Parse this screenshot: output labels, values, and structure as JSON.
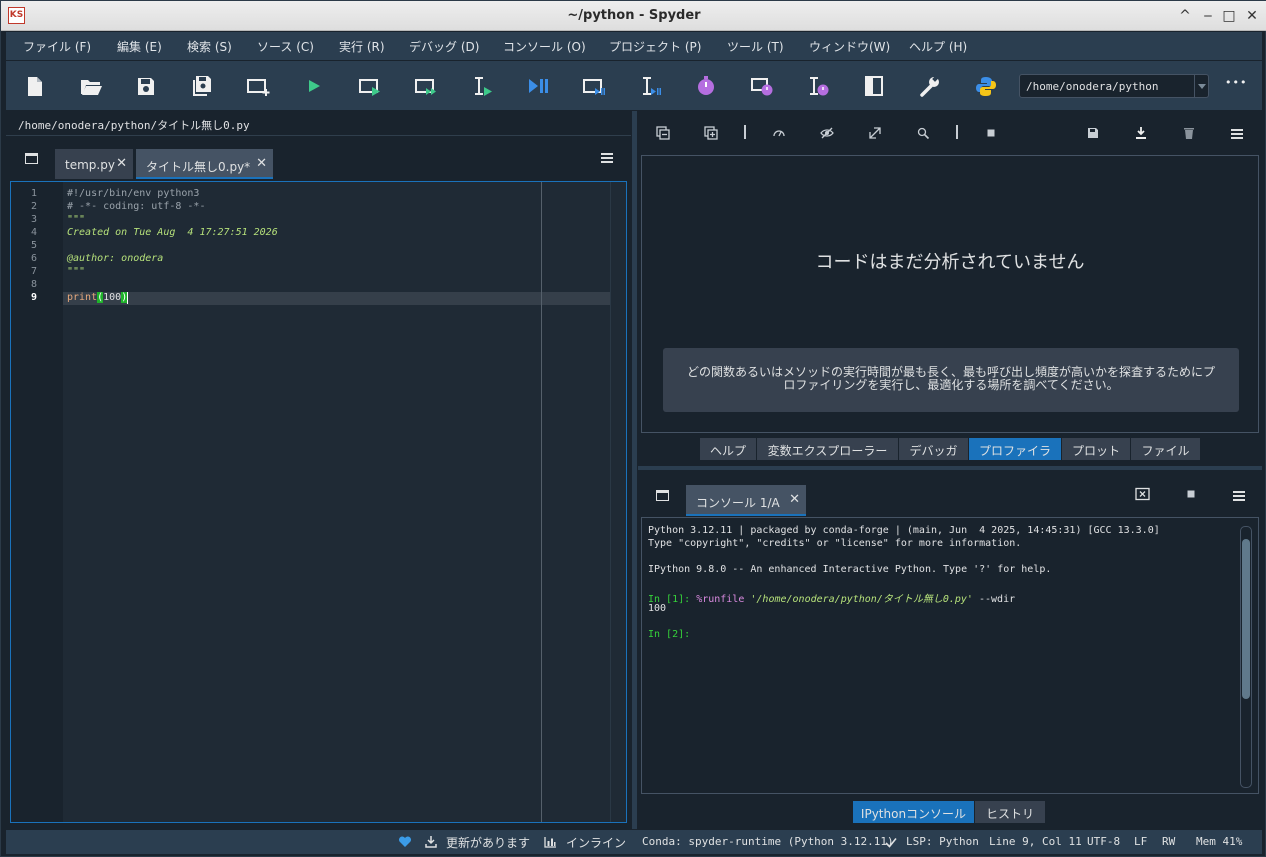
{
  "window": {
    "title": "~/python - Spyder",
    "logo": "spyder-logo",
    "controls": [
      "^",
      "‒",
      "□",
      "✕"
    ]
  },
  "menu": [
    {
      "label": "ファイル (F)"
    },
    {
      "label": "編集 (E)"
    },
    {
      "label": "検索 (S)"
    },
    {
      "label": "ソース (C)"
    },
    {
      "label": "実行 (R)"
    },
    {
      "label": "デバッグ (D)"
    },
    {
      "label": "コンソール (O)"
    },
    {
      "label": "プロジェクト (P)"
    },
    {
      "label": "ツール (T)"
    },
    {
      "label": "ウィンドウ(W)"
    },
    {
      "label": "ヘルプ (H)"
    }
  ],
  "toolbar": {
    "icons": [
      "new-file-icon",
      "open-file-icon",
      "save-icon",
      "save-all-icon",
      "new-cell-icon",
      "run-icon",
      "run-cell-icon",
      "run-cell-advance-icon",
      "run-selection-icon",
      "debug-icon",
      "debug-cell-icon",
      "debug-selection-icon",
      "profile-icon",
      "profile-cell-icon",
      "profile-selection-icon",
      "maximize-pane-icon",
      "preferences-icon",
      "python-path-icon"
    ],
    "working_dir": "/home/onodera/python",
    "more": "•••"
  },
  "editor": {
    "file_path": "/home/onodera/python/タイトル無し0.py",
    "tabs": [
      {
        "label": "temp.py",
        "active": false
      },
      {
        "label": "タイトル無し0.py*",
        "active": true
      }
    ],
    "current_line": "9",
    "lines": [
      {
        "n": "1",
        "text": "#!/usr/bin/env python3"
      },
      {
        "n": "2",
        "text": "# -*- coding: utf-8 -*-"
      },
      {
        "n": "3",
        "text": "\"\"\""
      },
      {
        "n": "4",
        "text": "Created on Tue Aug  4 17:27:51 2026"
      },
      {
        "n": "5",
        "text": ""
      },
      {
        "n": "6",
        "text": "@author: onodera"
      },
      {
        "n": "7",
        "text": "\"\"\""
      },
      {
        "n": "8",
        "text": ""
      },
      {
        "n": "9",
        "text": "print(100)"
      }
    ],
    "line9": {
      "fn": "print",
      "open": "(",
      "arg": "100",
      "close": ")"
    }
  },
  "profiler": {
    "heading": "コードはまだ分析されていません",
    "description": "どの関数あるいはメソッドの実行時間が最も長く、最も呼び出し頻度が高いかを探査するためにプロファイリングを実行し、最適化する場所を調べてください。",
    "tabs": [
      {
        "label": "ヘルプ"
      },
      {
        "label": "変数エクスプローラー"
      },
      {
        "label": "デバッガ"
      },
      {
        "label": "プロファイラ",
        "active": true
      },
      {
        "label": "プロット"
      },
      {
        "label": "ファイル"
      }
    ]
  },
  "console": {
    "tab_label": "コンソール 1/A",
    "lines": {
      "l1": "Python 3.12.11 | packaged by conda-forge | (main, Jun  4 2025, 14:45:31) [GCC 13.3.0]",
      "l2": "Type \"copyright\", \"credits\" or \"license\" for more information.",
      "l3": "IPython 9.8.0 -- An enhanced Interactive Python. Type '?' for help.",
      "in1_prompt": "In [1]:",
      "in1_magic": "%runfile",
      "in1_path": "'/home/onodera/python/タイトル無し0.py'",
      "in1_opt": "--wdir",
      "out1": "100",
      "in2_prompt": "In [2]:"
    },
    "tabs": [
      {
        "label": "IPythonコンソール",
        "active": true
      },
      {
        "label": "ヒストリ"
      }
    ]
  },
  "status": {
    "update": "更新があります",
    "inline": "インライン",
    "conda": "Conda: spyder-runtime (Python 3.12.11)",
    "lsp": "LSP: Python",
    "position": "Line 9, Col 11",
    "encoding": "UTF-8",
    "eol": "LF",
    "mode": "RW",
    "mem": "Mem 41%"
  },
  "colors": {
    "accent": "#1a72bb",
    "bar": "#2b3e50",
    "bg": "#19232d",
    "green": "#35d13a"
  }
}
